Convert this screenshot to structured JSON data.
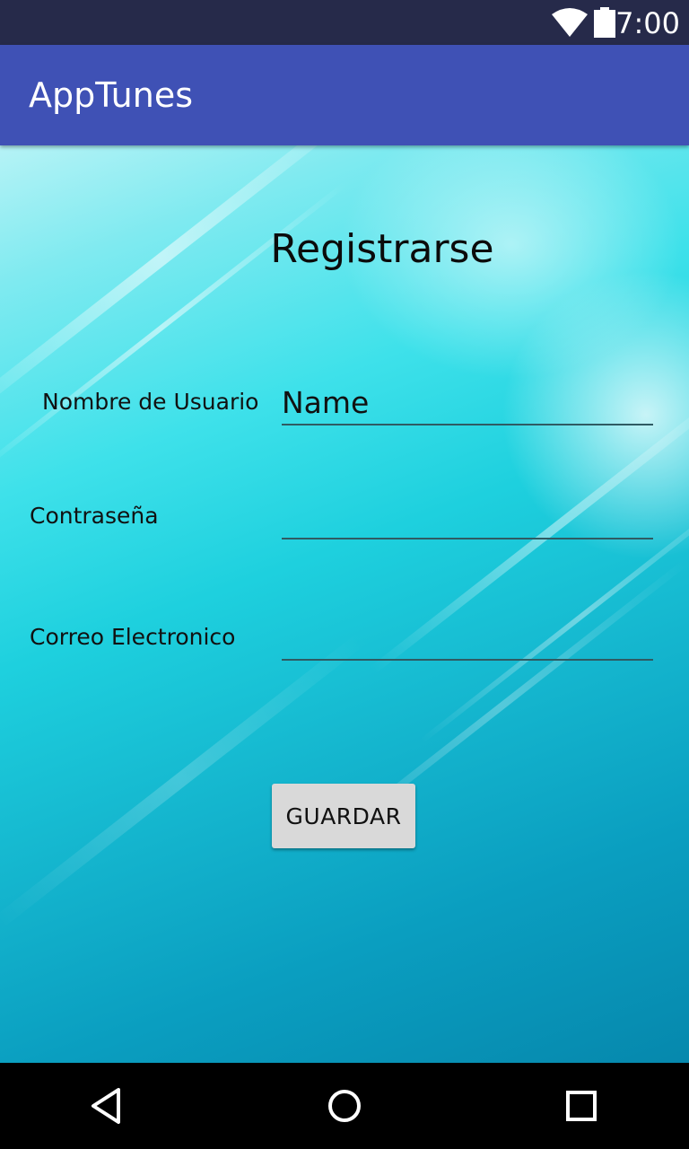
{
  "status_bar": {
    "time": "7:00",
    "icons": [
      "wifi-icon",
      "battery-icon"
    ]
  },
  "app_bar": {
    "title": "AppTunes",
    "color": "#3f51b5"
  },
  "form": {
    "title": "Registrarse",
    "fields": [
      {
        "label": "Nombre de Usuario",
        "value": "Name",
        "placeholder": ""
      },
      {
        "label": "Contraseña",
        "value": "",
        "placeholder": ""
      },
      {
        "label": "Correo Electronico",
        "value": "",
        "placeholder": ""
      }
    ],
    "save_label": "GUARDAR"
  },
  "nav_bar": {
    "icons": [
      "back-icon",
      "home-icon",
      "recents-icon"
    ]
  }
}
